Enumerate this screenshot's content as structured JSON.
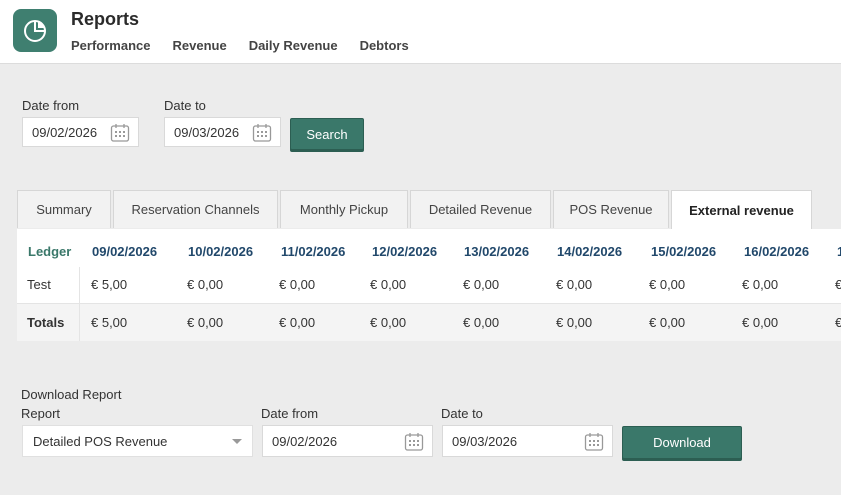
{
  "header": {
    "title": "Reports",
    "nav": [
      "Performance",
      "Revenue",
      "Daily Revenue",
      "Debtors"
    ]
  },
  "search": {
    "date_from_label": "Date from",
    "date_from_value": "09/02/2026",
    "date_to_label": "Date to",
    "date_to_value": "09/03/2026",
    "button_label": "Search"
  },
  "tabs": [
    {
      "label": "Summary",
      "active": false
    },
    {
      "label": "Reservation Channels",
      "active": false
    },
    {
      "label": "Monthly Pickup",
      "active": false
    },
    {
      "label": "Detailed Revenue",
      "active": false
    },
    {
      "label": "POS Revenue",
      "active": false
    },
    {
      "label": "External revenue",
      "active": true
    }
  ],
  "table": {
    "ledger_header": "Ledger",
    "columns": [
      "09/02/2026",
      "10/02/2026",
      "11/02/2026",
      "12/02/2026",
      "13/02/2026",
      "14/02/2026",
      "15/02/2026",
      "16/02/2026",
      "1"
    ],
    "rows": [
      {
        "label": "Test",
        "values": [
          "€ 5,00",
          "€ 0,00",
          "€ 0,00",
          "€ 0,00",
          "€ 0,00",
          "€ 0,00",
          "€ 0,00",
          "€ 0,00",
          "€"
        ]
      }
    ],
    "totals": {
      "label": "Totals",
      "values": [
        "€ 5,00",
        "€ 0,00",
        "€ 0,00",
        "€ 0,00",
        "€ 0,00",
        "€ 0,00",
        "€ 0,00",
        "€ 0,00",
        "€"
      ]
    }
  },
  "download": {
    "section_title": "Download Report",
    "report_label": "Report",
    "report_value": "Detailed POS Revenue",
    "date_from_label": "Date from",
    "date_from_value": "09/02/2026",
    "date_to_label": "Date to",
    "date_to_value": "09/03/2026",
    "button_label": "Download"
  },
  "colors": {
    "accent": "#3a786a",
    "header_date": "#21486b",
    "background": "#ececec"
  }
}
